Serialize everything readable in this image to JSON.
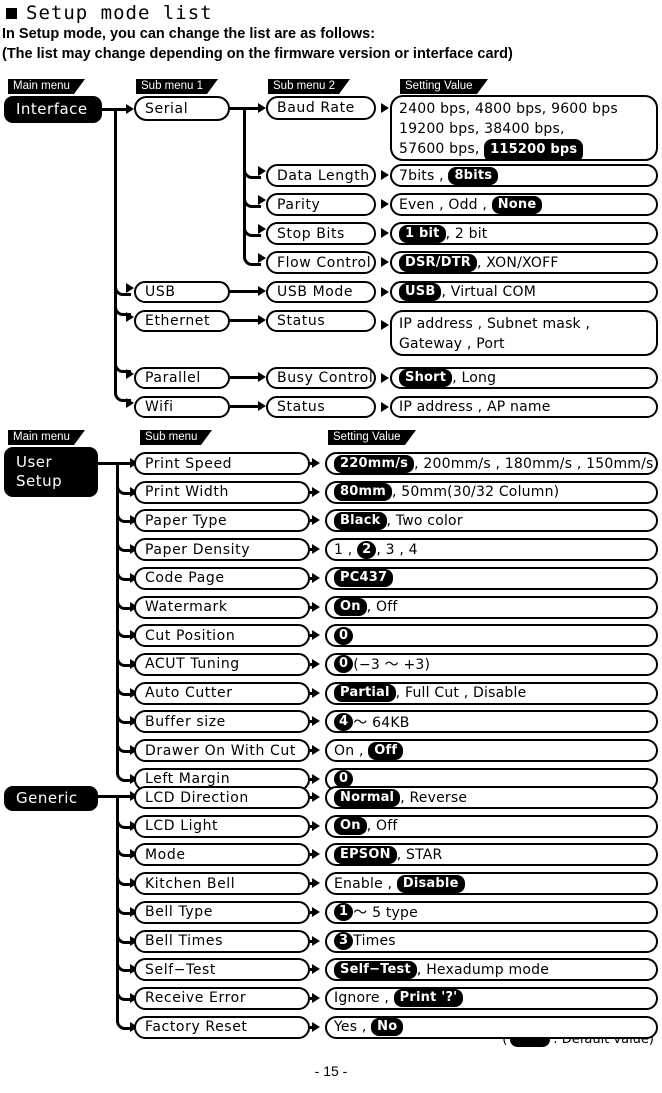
{
  "heading": {
    "title": "Setup mode list",
    "line1": "In Setup mode, you can change the list are as follows:",
    "line2": "(The list may change depending on the firmware version or interface card)"
  },
  "column_tags": {
    "main_menu": "Main menu",
    "sub_menu_1": "Sub menu 1",
    "sub_menu_2": "Sub menu 2",
    "sub_menu": "Sub menu",
    "setting_value": "Setting Value"
  },
  "sections": {
    "interface": {
      "main": "Interface",
      "sub1": {
        "serial": "Serial",
        "usb": "USB",
        "ethernet": "Ethernet",
        "parallel": "Parallel",
        "wifi": "Wifi"
      },
      "sub2": {
        "baud_rate": "Baud Rate",
        "data_length": "Data Length",
        "parity": "Parity",
        "stop_bits": "Stop Bits",
        "flow_control": "Flow Control",
        "usb_mode": "USB Mode",
        "eth_status": "Status",
        "busy_control": "Busy Control",
        "wifi_status": "Status"
      },
      "values": {
        "baud_rate_l1": "2400 bps, 4800 bps, 9600 bps",
        "baud_rate_l2": "19200 bps, 38400 bps,",
        "baud_rate_l3_pre": "57600 bps,",
        "baud_rate_default": "115200 bps",
        "data_length_pre": "7bits ,",
        "data_length_default": "8bits",
        "parity_pre": "Even , Odd ,",
        "parity_default": "None",
        "stop_bits_default": "1 bit",
        "stop_bits_post": ", 2 bit",
        "flow_control_default": "DSR/DTR",
        "flow_control_post": ", XON/XOFF",
        "usb_mode_default": "USB",
        "usb_mode_post": ", Virtual COM",
        "eth_status_l1": "IP address , Subnet mask ,",
        "eth_status_l2": "Gateway , Port",
        "busy_control_default": "Short",
        "busy_control_post": ", Long",
        "wifi_status": "IP address , AP name"
      }
    },
    "user_setup": {
      "main_line1": "User",
      "main_line2": "Setup",
      "rows": [
        {
          "label": "Print Speed",
          "default": "220mm/s",
          "post": ", 200mm/s , 180mm/s , 150mm/s",
          "pre": "",
          "default_shape": "pill"
        },
        {
          "label": "Print Width",
          "default": "80mm",
          "post": ", 50mm(30/32 Column)",
          "pre": "",
          "default_shape": "pill"
        },
        {
          "label": "Paper Type",
          "default": "Black",
          "post": ", Two color",
          "pre": "",
          "default_shape": "pill"
        },
        {
          "label": "Paper Density",
          "default": "2",
          "post": ", 3 , 4",
          "pre": "1 ,",
          "default_shape": "round"
        },
        {
          "label": "Code Page",
          "default": "PC437",
          "post": "",
          "pre": "",
          "default_shape": "pill"
        },
        {
          "label": "Watermark",
          "default": "On",
          "post": ", Off",
          "pre": "",
          "default_shape": "pill"
        },
        {
          "label": "Cut Position",
          "default": "0",
          "post": "",
          "pre": "",
          "default_shape": "round"
        },
        {
          "label": "ACUT Tuning",
          "default": "0",
          "post": " (−3 ～ +3)",
          "pre": "",
          "default_shape": "round"
        },
        {
          "label": "Auto Cutter",
          "default": "Partial",
          "post": ", Full Cut , Disable",
          "pre": "",
          "default_shape": "pill"
        },
        {
          "label": "Buffer size",
          "default": "4",
          "post": " ～ 64KB",
          "pre": "",
          "default_shape": "round"
        },
        {
          "label": "Drawer On With Cut",
          "default": "Off",
          "post": "",
          "pre": "On ,",
          "default_shape": "pill"
        },
        {
          "label": "Left Margin",
          "default": "0",
          "post": "",
          "pre": "",
          "default_shape": "round"
        }
      ]
    },
    "generic": {
      "main": "Generic",
      "rows": [
        {
          "label": "LCD Direction",
          "default": "Normal",
          "post": ", Reverse",
          "pre": "",
          "default_shape": "pill"
        },
        {
          "label": "LCD Light",
          "default": "On",
          "post": ", Off",
          "pre": "",
          "default_shape": "pill"
        },
        {
          "label": "Mode",
          "default": "EPSON",
          "post": ", STAR",
          "pre": "",
          "default_shape": "pill"
        },
        {
          "label": "Kitchen Bell",
          "default": "Disable",
          "post": "",
          "pre": "Enable ,",
          "default_shape": "pill"
        },
        {
          "label": "Bell Type",
          "default": "1",
          "post": " ～ 5 type",
          "pre": "",
          "default_shape": "round"
        },
        {
          "label": "Bell Times",
          "default": "3",
          "post": " Times",
          "pre": "",
          "default_shape": "round"
        },
        {
          "label": "Self−Test",
          "default": "Self−Test",
          "post": ", Hexadump mode",
          "pre": "",
          "default_shape": "pill"
        },
        {
          "label": "Receive Error",
          "default": "Print '?'",
          "post": "",
          "pre": "Ignore ,",
          "default_shape": "pill"
        },
        {
          "label": "Factory Reset",
          "default": "No",
          "post": "",
          "pre": "Yes ,",
          "default_shape": "pill"
        }
      ]
    }
  },
  "legend": {
    "open_paren": "(",
    "text": ": Default value",
    "close_paren": ")"
  },
  "page_number": "- 15 -"
}
